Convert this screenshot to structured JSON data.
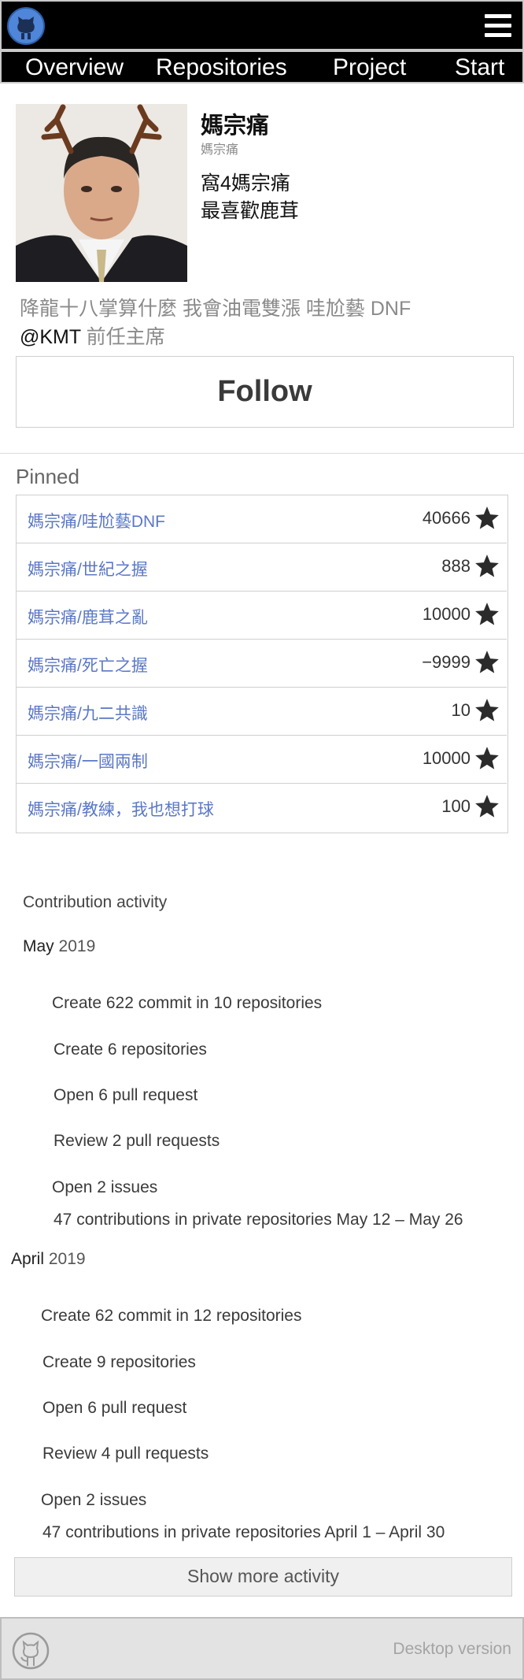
{
  "header": {
    "logo_icon": "github-octocat-icon",
    "menu_icon": "hamburger-menu-icon"
  },
  "nav": {
    "items": [
      "Overview",
      "Repositories",
      "Project",
      "Start"
    ]
  },
  "profile": {
    "name": "媽宗痛",
    "login": "媽宗痛",
    "bio_line1": "窩4媽宗痛",
    "bio_line2": "最喜歡鹿茸",
    "tagline": "降龍十八掌算什麼 我會油電雙漲 哇尬藝 DNF",
    "org_name": "@KMT",
    "org_role": " 前任主席",
    "follow_label": "Follow"
  },
  "pinned": {
    "title": "Pinned",
    "star_icon": "star-icon",
    "items": [
      {
        "name": "媽宗痛/哇尬藝DNF",
        "stars": "40666"
      },
      {
        "name": "媽宗痛/世紀之握",
        "stars": "888"
      },
      {
        "name": "媽宗痛/鹿茸之亂",
        "stars": "10000"
      },
      {
        "name": "媽宗痛/死亡之握",
        "stars": "−9999"
      },
      {
        "name": "媽宗痛/九二共識",
        "stars": "10"
      },
      {
        "name": "媽宗痛/一國兩制",
        "stars": "10000"
      },
      {
        "name": "媽宗痛/教練，我也想打球",
        "stars": "100"
      }
    ]
  },
  "contributions": {
    "title": "Contribution activity",
    "months": [
      {
        "name": "May",
        "year": "2019",
        "items": [
          "Create 622 commit in 10 repositories",
          "Create 6 repositories",
          "Open 6 pull request",
          "Review 2 pull requests",
          "Open 2 issues",
          "47 contributions in private repositories May 12 – May 26"
        ]
      },
      {
        "name": "April",
        "year": "2019",
        "items": [
          "Create 62 commit in 12 repositories",
          "Create 9 repositories",
          "Open 6 pull request",
          "Review 4 pull requests",
          "Open 2 issues",
          "47 contributions in private repositories April 1 – April 30"
        ]
      }
    ],
    "show_more_label": "Show more activity"
  },
  "footer": {
    "logo_icon": "github-octocat-outline-icon",
    "desktop_label": "Desktop version"
  },
  "colors": {
    "link": "#5b78c6",
    "header_bg": "#000000",
    "footer_bg": "#e3e3e3"
  }
}
